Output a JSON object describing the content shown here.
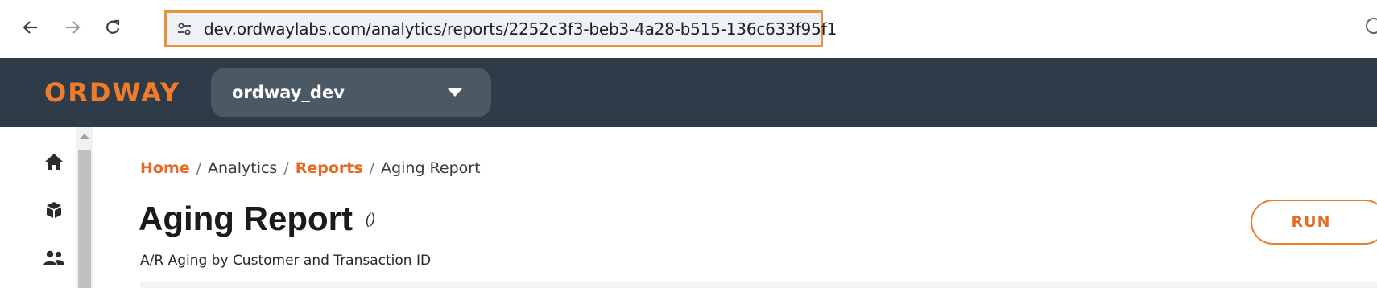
{
  "browser": {
    "url": "dev.ordwaylabs.com/analytics/reports/2252c3f3-beb3-4a28-b515-136c633f95f1",
    "back_icon": "arrow-left-icon",
    "forward_icon": "arrow-right-icon",
    "reload_icon": "reload-icon",
    "highlight_color": "#e8923a"
  },
  "header": {
    "logo": "ORDWAY",
    "workspace": "ordway_dev",
    "bg_color": "#2d3c48",
    "brand_color": "#ef7c2a"
  },
  "sidebar": {
    "items": [
      {
        "icon": "home-icon"
      },
      {
        "icon": "cube-icon"
      },
      {
        "icon": "users-icon"
      }
    ]
  },
  "breadcrumb": {
    "home": "Home",
    "sep1": "/",
    "analytics": "Analytics",
    "sep2": "/",
    "reports": "Reports",
    "sep3": "/",
    "current": "Aging Report"
  },
  "page": {
    "title": "Aging Report",
    "title_mark": "()",
    "subtitle": "A/R Aging by Customer and Transaction ID",
    "run_label": "RUN"
  }
}
